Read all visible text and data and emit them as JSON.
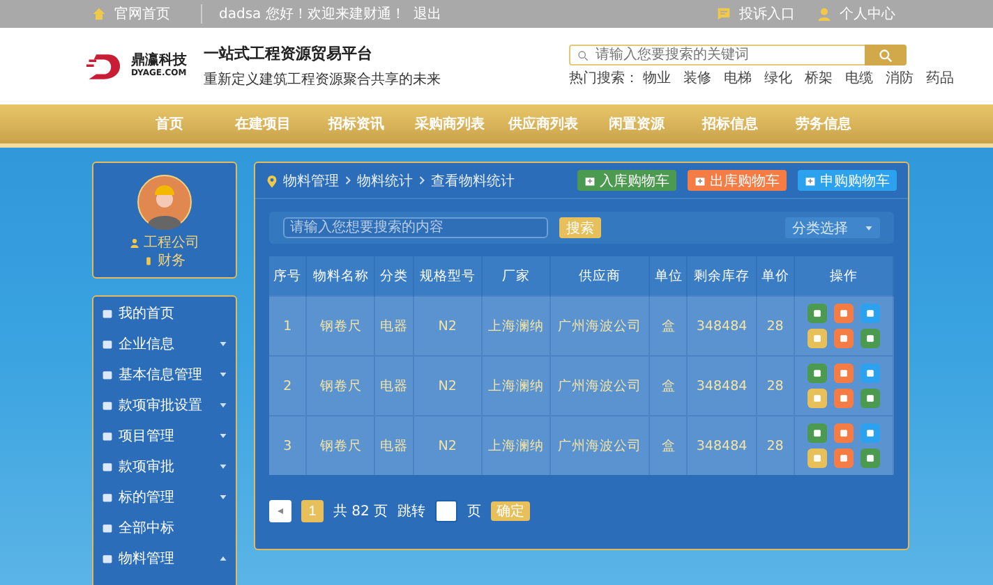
{
  "topbar": {
    "home": "官网首页",
    "greeting": "dadsa 您好！欢迎来建财通！",
    "logout": "退出",
    "complaint": "投诉入口",
    "account": "个人中心"
  },
  "header": {
    "logo_name": "鼎瀛科技",
    "logo_domain": "DYAGE.COM",
    "title": "一站式工程资源贸易平台",
    "subtitle": "重新定义建筑工程资源聚合共享的未来",
    "search": {
      "placeholder": "请输入您要搜索的关键词"
    },
    "hot_label": "热门搜索：",
    "hot": [
      "物业",
      "装修",
      "电梯",
      "绿化",
      "桥架",
      "电缆",
      "消防",
      "药品"
    ]
  },
  "nav": [
    "首页",
    "在建项目",
    "招标资讯",
    "采购商列表",
    "供应商列表",
    "闲置资源",
    "招标信息",
    "劳务信息"
  ],
  "profile": {
    "company": "工程公司",
    "role": "财务"
  },
  "sidebar": {
    "items": [
      {
        "label": "我的首页",
        "kind": "link"
      },
      {
        "label": "企业信息",
        "kind": "group",
        "expanded": false
      },
      {
        "label": "基本信息管理",
        "kind": "group",
        "expanded": false
      },
      {
        "label": "款项审批设置",
        "kind": "group",
        "expanded": false
      },
      {
        "label": "项目管理",
        "kind": "group",
        "expanded": false
      },
      {
        "label": "款项审批",
        "kind": "group",
        "expanded": false
      },
      {
        "label": "标的管理",
        "kind": "group",
        "expanded": false
      },
      {
        "label": "全部中标",
        "kind": "link"
      },
      {
        "label": "物料管理",
        "kind": "group",
        "expanded": true
      }
    ]
  },
  "breadcrumb": [
    "物料管理",
    "物料统计",
    "查看物料统计"
  ],
  "cart_buttons": [
    {
      "label": "入库购物车",
      "color": "#4c9a4f"
    },
    {
      "label": "出库购物车",
      "color": "#f57c45"
    },
    {
      "label": "申购购物车",
      "color": "#2ca2ee"
    }
  ],
  "filter": {
    "placeholder": "请输入您想要搜索的内容",
    "search_button": "搜索",
    "category": "分类选择"
  },
  "table": {
    "columns": [
      "序号",
      "物料名称",
      "分类",
      "规格型号",
      "厂家",
      "供应商",
      "单位",
      "剩余库存",
      "单价",
      "操作"
    ],
    "rows": [
      [
        "1",
        "钢卷尺",
        "电器",
        "N2",
        "上海澜纳",
        "广州海波公司",
        "盒",
        "348484",
        "28"
      ],
      [
        "2",
        "钢卷尺",
        "电器",
        "N2",
        "上海澜纳",
        "广州海波公司",
        "盒",
        "348484",
        "28"
      ],
      [
        "3",
        "钢卷尺",
        "电器",
        "N2",
        "上海澜纳",
        "广州海波公司",
        "盒",
        "348484",
        "28"
      ]
    ]
  },
  "pagination": {
    "current": "1",
    "total": "共 82 页",
    "goto": "跳转",
    "page_unit": "页",
    "confirm": "确定"
  }
}
